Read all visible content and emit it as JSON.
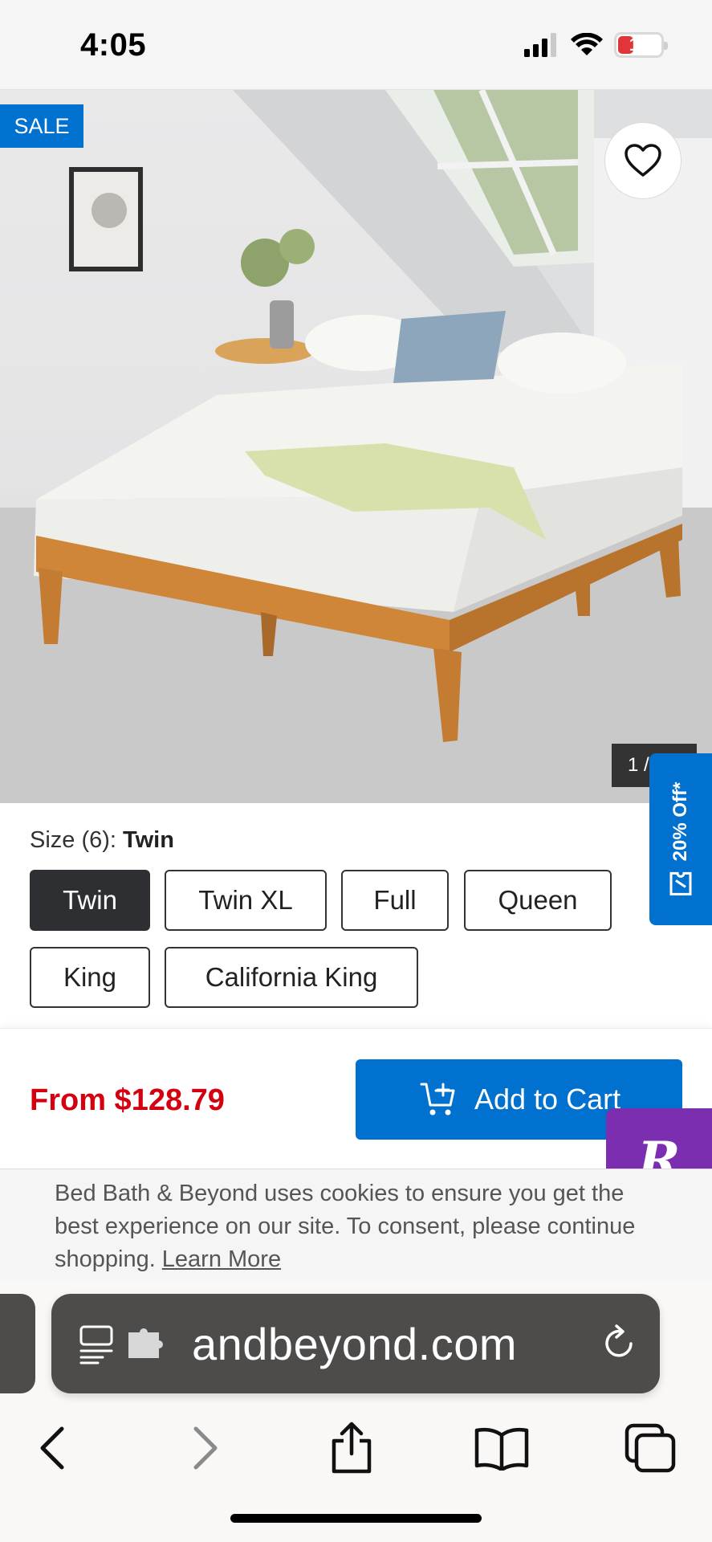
{
  "status_bar": {
    "time": "4:05",
    "battery_level": "19",
    "battery_fraction": 0.19,
    "icons": [
      "cellular-signal-icon",
      "wifi-icon",
      "battery-icon"
    ]
  },
  "product": {
    "badge": "SALE",
    "image_alt": "wooden platform bed frame",
    "image_counter": "1 /",
    "favorite_icon": "heart-icon"
  },
  "promo_tab": {
    "label": "20% Off*",
    "icon": "ticket-icon"
  },
  "size": {
    "label": "Size (6):",
    "selected": "Twin",
    "options": [
      "Twin",
      "Twin XL",
      "Full",
      "Queen",
      "King",
      "California King"
    ]
  },
  "purchase": {
    "price": "From $128.79",
    "cart_label": "Add to Cart",
    "cart_icon": "cart-add-icon"
  },
  "reviews_badge": {
    "letter": "R",
    "color": "#7b2fb0"
  },
  "cookie": {
    "text": "Bed Bath & Beyond uses cookies to ensure you get the best experience on our site. To consent, please continue shopping.",
    "link": "Learn More"
  },
  "browser": {
    "url": "andbeyond.com",
    "icons": [
      "reader-icon",
      "extension-icon",
      "reload-icon"
    ],
    "nav": [
      "back-icon",
      "forward-icon",
      "share-icon",
      "bookmarks-icon",
      "tabs-icon"
    ]
  },
  "colors": {
    "accent": "#0071ce",
    "price": "#d4000f",
    "selected_size": "#2d2f33"
  }
}
